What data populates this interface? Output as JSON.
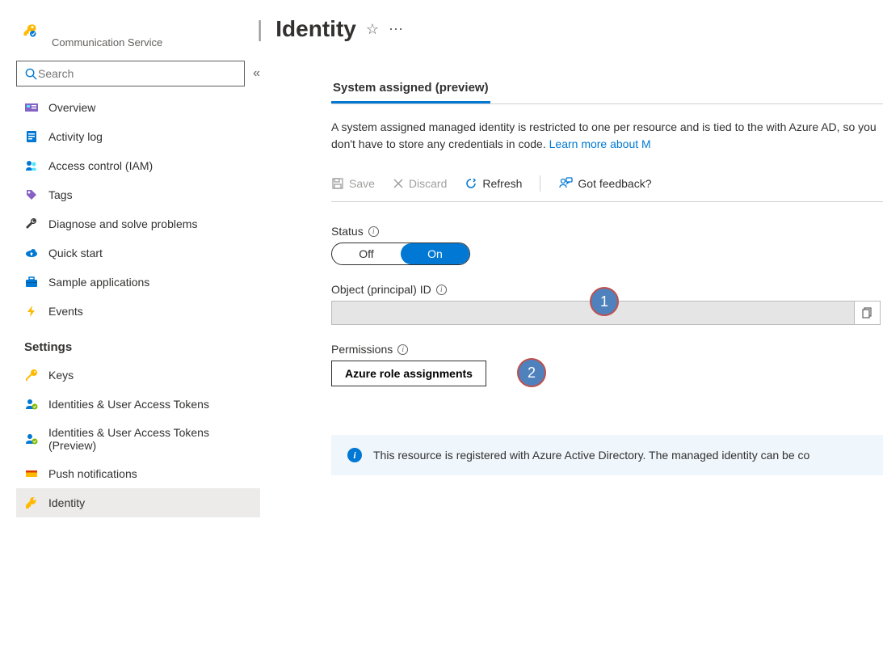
{
  "header": {
    "service_type": "Communication Service",
    "page_title": "Identity"
  },
  "sidebar": {
    "search_placeholder": "Search",
    "items": [
      {
        "label": "Overview",
        "icon": "overview"
      },
      {
        "label": "Activity log",
        "icon": "log"
      },
      {
        "label": "Access control (IAM)",
        "icon": "people"
      },
      {
        "label": "Tags",
        "icon": "tag"
      },
      {
        "label": "Diagnose and solve problems",
        "icon": "wrench"
      },
      {
        "label": "Quick start",
        "icon": "cloud"
      },
      {
        "label": "Sample applications",
        "icon": "briefcase"
      },
      {
        "label": "Events",
        "icon": "bolt"
      }
    ],
    "section_header": "Settings",
    "settings_items": [
      {
        "label": "Keys",
        "icon": "key"
      },
      {
        "label": "Identities & User Access Tokens",
        "icon": "usertoken"
      },
      {
        "label": "Identities & User Access Tokens (Preview)",
        "icon": "usertoken"
      },
      {
        "label": "Push notifications",
        "icon": "notif"
      },
      {
        "label": "Identity",
        "icon": "identity",
        "selected": true
      }
    ]
  },
  "main": {
    "tab_label": "System assigned (preview)",
    "description": "A system assigned managed identity is restricted to one per resource and is tied to the with Azure AD, so you don't have to store any credentials in code. ",
    "learn_more": "Learn more about M",
    "toolbar": {
      "save": "Save",
      "discard": "Discard",
      "refresh": "Refresh",
      "feedback": "Got feedback?"
    },
    "status": {
      "label": "Status",
      "off": "Off",
      "on": "On"
    },
    "object_id": {
      "label": "Object (principal) ID",
      "value": ""
    },
    "permissions": {
      "label": "Permissions",
      "button": "Azure role assignments"
    },
    "infobox": "This resource is registered with Azure Active Directory. The managed identity can be co",
    "callouts": {
      "c1": "1",
      "c2": "2"
    }
  }
}
